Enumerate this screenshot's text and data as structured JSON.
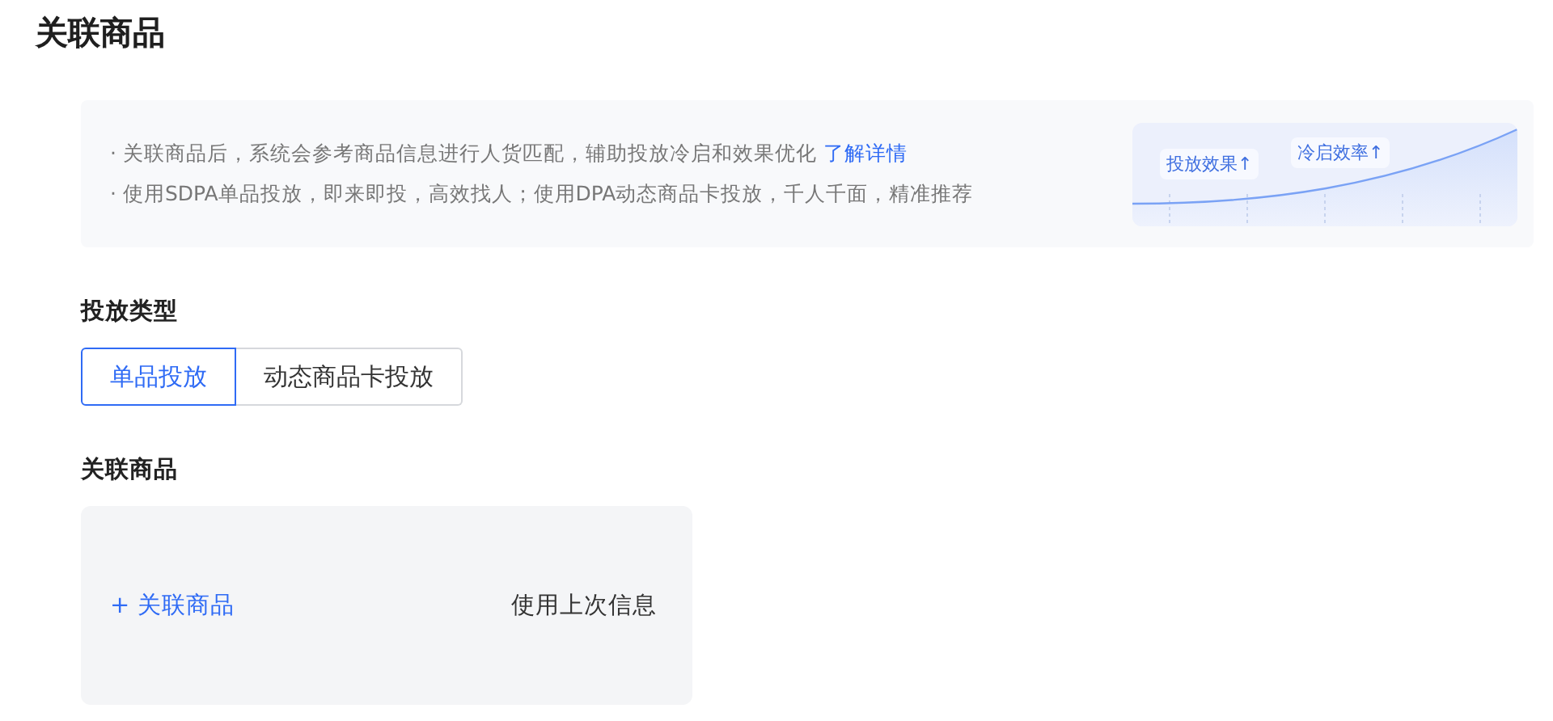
{
  "title": "关联商品",
  "notice": {
    "lines": [
      {
        "text": "· 关联商品后，系统会参考商品信息进行人货匹配，辅助投放冷启和效果优化",
        "link": "了解详情"
      },
      {
        "text": "· 使用SDPA单品投放，即来即投，高效找人；使用DPA动态商品卡投放，千人千面，精准推荐"
      }
    ],
    "chart_tags": [
      "投放效果↑",
      "冷启效率↑"
    ]
  },
  "delivery_type": {
    "label": "投放类型",
    "options": [
      {
        "label": "单品投放",
        "selected": true
      },
      {
        "label": "动态商品卡投放",
        "selected": false
      }
    ]
  },
  "products": {
    "label": "关联商品",
    "add_link": "+ 关联商品",
    "reuse_link": "使用上次信息"
  }
}
